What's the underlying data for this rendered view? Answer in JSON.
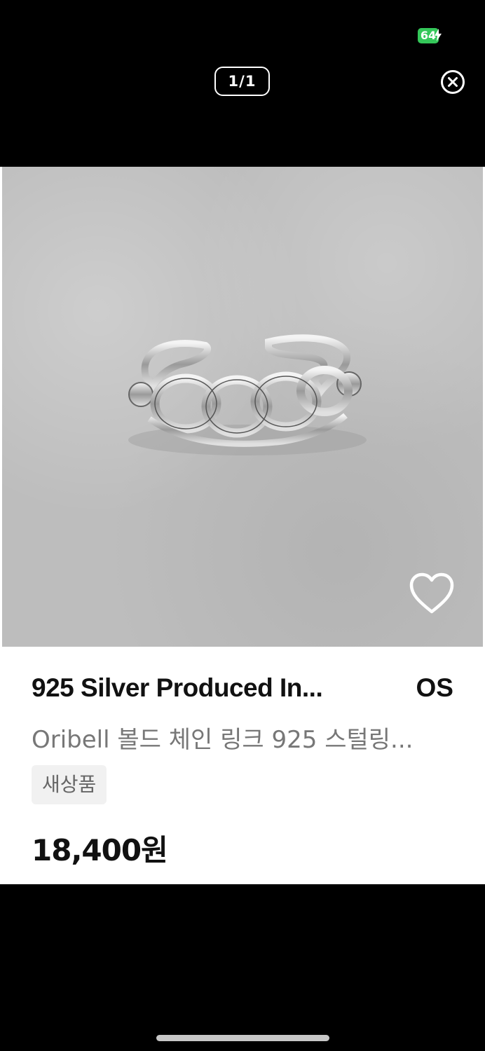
{
  "status_bar": {
    "battery_level": "64",
    "charging": true,
    "battery_color": "#34c759"
  },
  "viewer": {
    "page_counter": "1/1",
    "close_icon": "close-circle-icon"
  },
  "product": {
    "title": "925 Silver Produced In...",
    "size": "OS",
    "subtitle": "Oribell 볼드 체인 링크 925 스털링...",
    "condition_badge": "새상품",
    "price": "18,400원",
    "favorite_icon": "heart-outline-icon"
  }
}
